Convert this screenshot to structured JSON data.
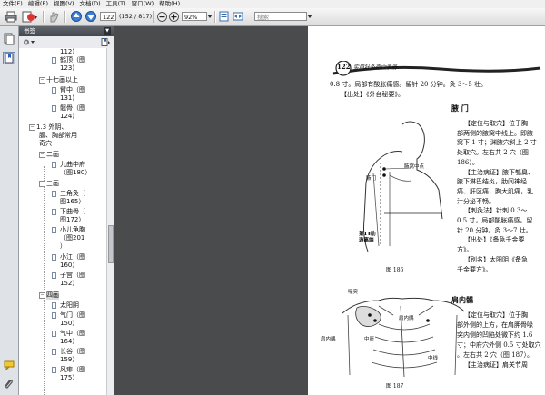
{
  "menubar": {
    "items": [
      "文件(F)",
      "编辑(E)",
      "视图(V)",
      "文档(D)",
      "工具(T)",
      "窗口(W)",
      "帮助(H)"
    ]
  },
  "toolbar": {
    "page_number": "122",
    "page_count": "(152 / 817)",
    "zoom": "92%",
    "search_placeholder": "搜索"
  },
  "bookmarks_panel": {
    "title": "书签",
    "items": [
      {
        "label": "112)"
      },
      {
        "label": "鹤顶（图"
      },
      {
        "label": "123)"
      },
      {
        "label": "十七画以上"
      },
      {
        "label": "臂中（图"
      },
      {
        "label": "131)"
      },
      {
        "label": "髋骨（图"
      },
      {
        "label": "124)"
      },
      {
        "label": "1.3 外阴、"
      },
      {
        "label": "腹、胸部常用"
      },
      {
        "label": "奇穴"
      },
      {
        "label": "二画"
      },
      {
        "label": "九曲中府"
      },
      {
        "label": "（图180）"
      },
      {
        "label": "三画"
      },
      {
        "label": "三角灸（"
      },
      {
        "label": "图165）"
      },
      {
        "label": "下曲骨（"
      },
      {
        "label": "图172）"
      },
      {
        "label": "小儿龟胸"
      },
      {
        "label": "（图201"
      },
      {
        "label": "）"
      },
      {
        "label": "小江（图"
      },
      {
        "label": "160）"
      },
      {
        "label": "子宫（图"
      },
      {
        "label": "152）"
      },
      {
        "label": "四画"
      },
      {
        "label": "太阳阴"
      },
      {
        "label": "气门（图"
      },
      {
        "label": "150）"
      },
      {
        "label": "气中（图"
      },
      {
        "label": "164）"
      },
      {
        "label": "长谷（图"
      },
      {
        "label": "159）"
      },
      {
        "label": "风痱（图"
      },
      {
        "label": "175）"
      }
    ]
  },
  "document": {
    "page_header_number": "122",
    "page_header_title": "实用针灸奇穴手册",
    "intro_line1": "0.8 寸。局部有酸胀痛感。留针 20 分钟。灸 3～5 壮。",
    "intro_line2": "【出处】《外台秘要》。",
    "section1_title": "腋 门",
    "section1_lines": [
      "【定位与取穴】位于胸",
      "部两侧的腋窝中线上。即腋",
      "窝下 1 寸；渊腋穴斜上 2 寸",
      "处取穴。左右共 2 穴（图",
      "186）。",
      "【主治病证】腋下瓠臭、",
      "腋下淋巴结炎，肋间神经",
      "痛、肝区痛，胸大肌痛，乳",
      "汁分泌不畅。",
      "【刺灸法】针刺 0.3～",
      "0.5 寸，局部酸胀痛感。留",
      "针 20 分钟。灸 3～7 壮。",
      "【出处】《备急千金要",
      "方》。",
      "【别名】太阳阴《备急",
      "千金要方》。"
    ],
    "section2_title": "肩内髃",
    "section2_lines": [
      "【定位与取穴】位于胸",
      "部外侧的上方，在肩胛骨喙",
      "突内侧的凹陷处微下约 1.6",
      "寸；中府穴外侧 0.5 寸处取穴",
      "。左右共 2 穴（图 187）。",
      "【主治病证】肩关节周"
    ],
    "figure1": {
      "caption": "图 186",
      "labels": [
        "腋窝中点",
        "腋门",
        "第11肋",
        "游离端"
      ]
    },
    "figure2": {
      "caption": "图 187",
      "labels": [
        "喙突",
        "肩内髃",
        "肩内髃",
        "中府",
        "中线"
      ]
    }
  }
}
